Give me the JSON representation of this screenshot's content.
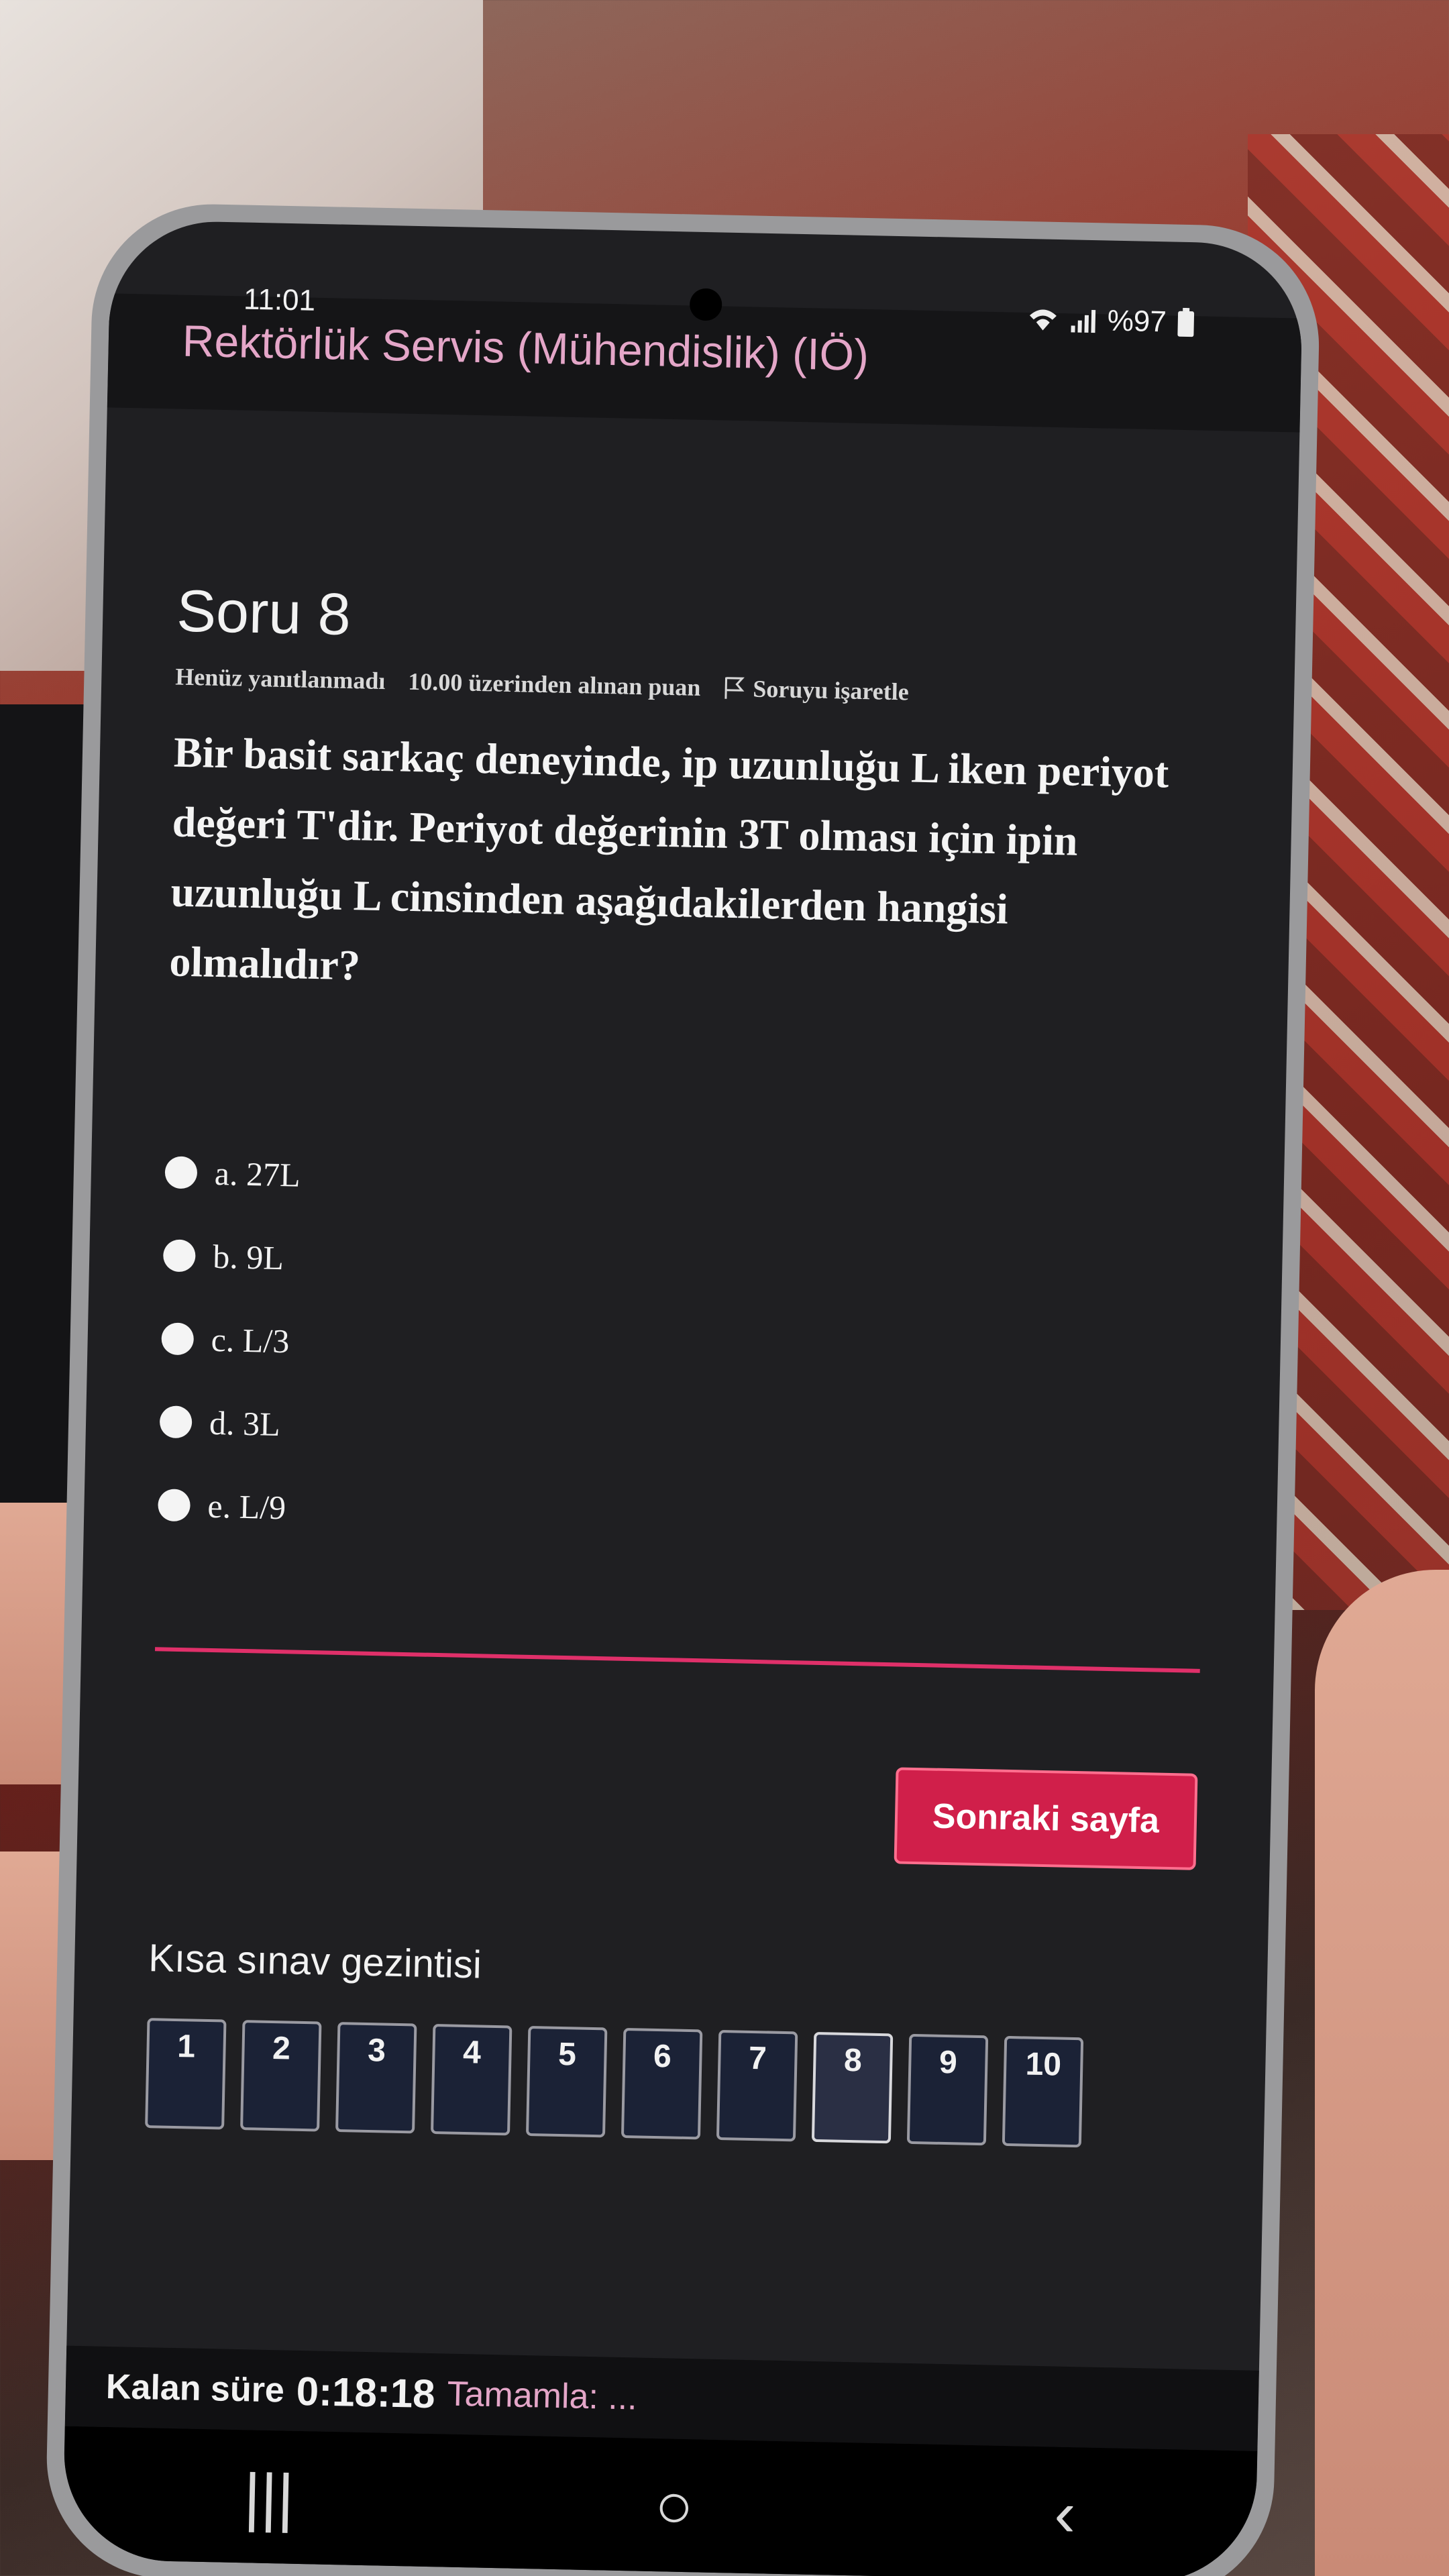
{
  "status_bar": {
    "time": "11:01",
    "battery": "%97"
  },
  "course_title": "Rektörlük Servis (Mühendislik) (IÖ)",
  "question": {
    "number_label": "Soru 8",
    "state": "Henüz yanıtlanmadı",
    "points": "10.00 üzerinden alınan puan",
    "flag_label": "Soruyu işaretle",
    "text": "Bir basit sarkaç deneyinde, ip uzunluğu L iken periyot değeri T'dir. Periyot değerinin 3T olması için ipin uzunluğu L cinsinden aşağıdakilerden hangisi olmalıdır?",
    "options": [
      {
        "label": "a. 27L"
      },
      {
        "label": "b. 9L"
      },
      {
        "label": "c. L/3"
      },
      {
        "label": "d. 3L"
      },
      {
        "label": "e. L/9"
      }
    ]
  },
  "next_button": "Sonraki sayfa",
  "quiz_nav": {
    "title": "Kısa sınav gezintisi",
    "items": [
      "1",
      "2",
      "3",
      "4",
      "5",
      "6",
      "7",
      "8",
      "9",
      "10"
    ],
    "current": "8"
  },
  "bottom": {
    "timer_label": "Kalan süre",
    "timer_value": "0:18:18",
    "finish_text": "Tamamla: ..."
  },
  "colors": {
    "accent": "#d01f4a",
    "separator": "#e0306a",
    "background": "#1f1f22"
  },
  "icons": [
    "wifi-icon",
    "signal-icon",
    "battery-icon",
    "flag-icon",
    "recent-apps-icon",
    "home-icon",
    "back-icon"
  ]
}
